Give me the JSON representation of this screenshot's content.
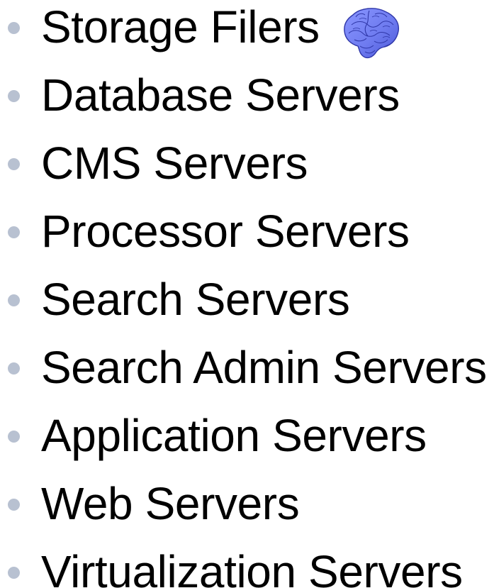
{
  "slide": {
    "bullets": [
      {
        "label": "Storage Filers"
      },
      {
        "label": "Database Servers"
      },
      {
        "label": "CMS Servers"
      },
      {
        "label": "Processor Servers"
      },
      {
        "label": "Search Servers"
      },
      {
        "label": "Search Admin Servers"
      },
      {
        "label": "Application Servers"
      },
      {
        "label": "Web Servers"
      },
      {
        "label": "Virtualization Servers"
      }
    ],
    "icon": "brain-icon",
    "colors": {
      "bullet": "#b8c1d1",
      "text": "#000000",
      "brain_fill": "#6f7cf0",
      "brain_line": "#2f37a8"
    }
  }
}
